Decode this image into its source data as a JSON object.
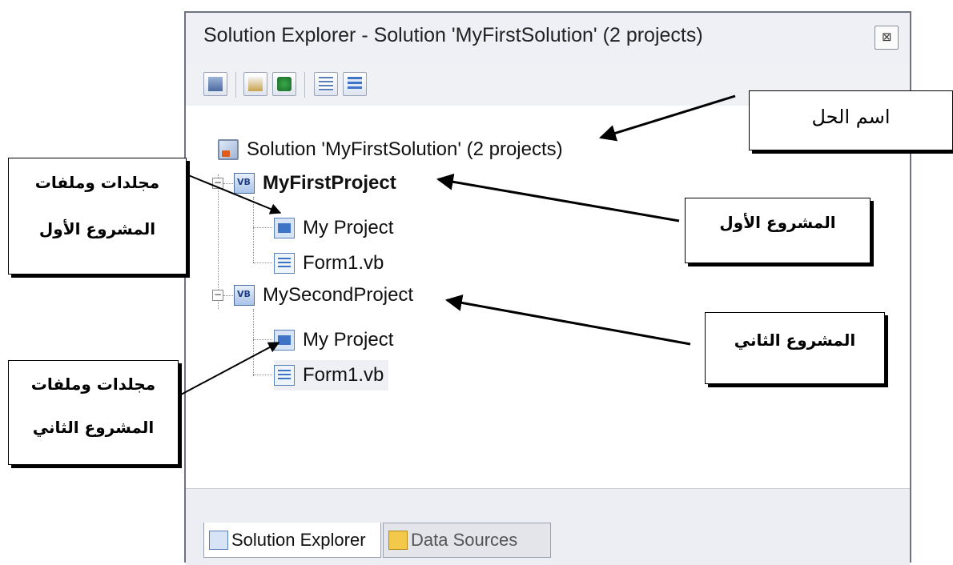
{
  "window": {
    "title": "Solution Explorer - Solution 'MyFirstSolution' (2 projects)",
    "close_glyph": "⊠"
  },
  "toolbar": {
    "buttons": [
      {
        "icon": "properties-icon"
      },
      {
        "icon": "show-all-files-icon"
      },
      {
        "icon": "refresh-icon"
      },
      {
        "icon": "view-code-icon"
      },
      {
        "icon": "view-designer-icon"
      }
    ]
  },
  "tree": {
    "solution": "Solution 'MyFirstSolution' (2 projects)",
    "project1": {
      "name": "MyFirstProject",
      "expander": "−",
      "items": [
        "My Project",
        "Form1.vb"
      ]
    },
    "project2": {
      "name": "MySecondProject",
      "expander": "−",
      "items": [
        "My Project",
        "Form1.vb"
      ]
    }
  },
  "tabs": {
    "solution_explorer": "Solution Explorer",
    "data_sources": "Data Sources"
  },
  "annotations": {
    "solution_name": "اسم الحل",
    "first_project": "المشروع الأول",
    "second_project": "المشروع الثاني",
    "first_files": {
      "line1": "مجلدات وملفات",
      "line2": "المشروع الأول"
    },
    "second_files": {
      "line1": "مجلدات وملفات",
      "line2": "المشروع الثاني"
    }
  },
  "colors": {
    "window_border": "#6f7380",
    "window_bg": "#f3f4f7",
    "tree_bg": "#ffffff",
    "arrow": "#000000"
  }
}
